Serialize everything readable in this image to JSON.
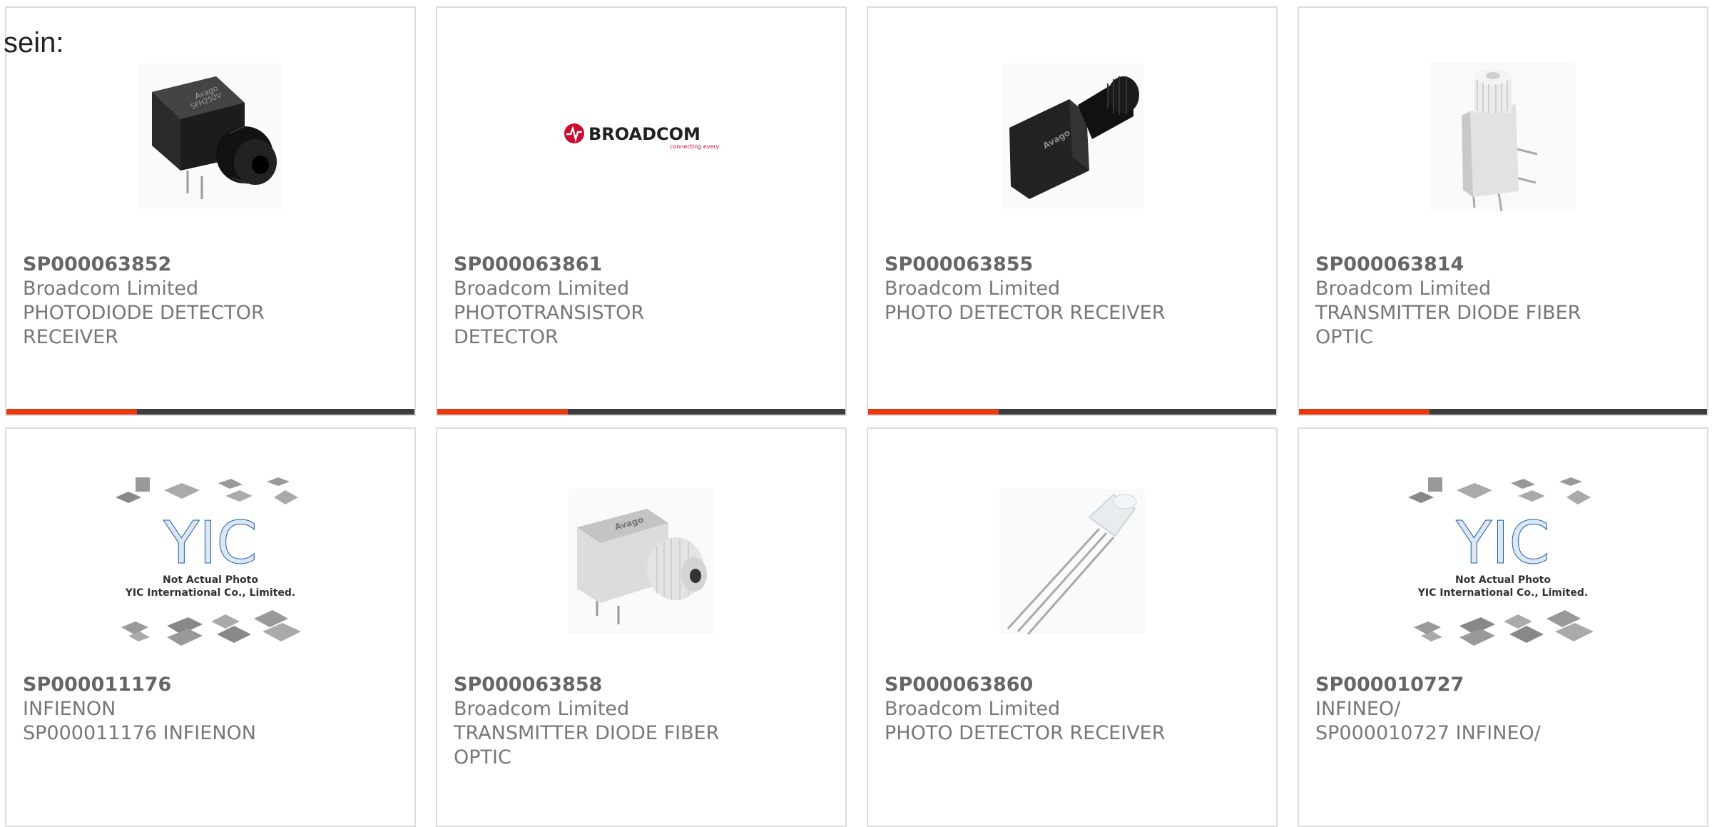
{
  "page": {
    "lead_text": "sein:"
  },
  "products": [
    {
      "part_number": "SP000063852",
      "manufacturer": "Broadcom Limited",
      "description": "PHOTODIODE DETECTOR RECEIVER",
      "image": "black-fiber-optic-receiver-photo",
      "photo_print": "Avago",
      "photo_print_2": "SFH250V"
    },
    {
      "part_number": "SP000063861",
      "manufacturer": "Broadcom Limited",
      "description": "PHOTOTRANSISTOR DETECTOR",
      "image": "broadcom-logo",
      "logo_text": "BROADCOM",
      "logo_tagline": "connecting everything"
    },
    {
      "part_number": "SP000063855",
      "manufacturer": "Broadcom Limited",
      "description": "PHOTO DETECTOR RECEIVER",
      "image": "black-fiber-optic-detector-photo",
      "photo_print": "Avago"
    },
    {
      "part_number": "SP000063814",
      "manufacturer": "Broadcom Limited",
      "description": "TRANSMITTER DIODE FIBER OPTIC",
      "image": "white-fiber-optic-transmitter-photo"
    },
    {
      "part_number": "SP000011176",
      "manufacturer": "INFIENON",
      "description": "SP000011176 INFIENON",
      "image": "not-actual-photo-placeholder",
      "placeholder_logo": "YIC",
      "placeholder_line1": "Not Actual Photo",
      "placeholder_line2": "YIC International Co., Limited."
    },
    {
      "part_number": "SP000063858",
      "manufacturer": "Broadcom Limited",
      "description": "TRANSMITTER DIODE FIBER OPTIC",
      "image": "grey-fiber-optic-transmitter-photo",
      "photo_print": "Avago"
    },
    {
      "part_number": "SP000063860",
      "manufacturer": "Broadcom Limited",
      "description": "PHOTO DETECTOR RECEIVER",
      "image": "clear-led-photodetector-photo"
    },
    {
      "part_number": "SP000010727",
      "manufacturer": "INFINEO/",
      "description": "SP000010727 INFINEO/",
      "image": "not-actual-photo-placeholder",
      "placeholder_logo": "YIC",
      "placeholder_line1": "Not Actual Photo",
      "placeholder_line2": "YIC International Co., Limited."
    }
  ],
  "colors": {
    "accent": "#e8380d",
    "bar_dark": "#3c3c3c",
    "card_border": "#dddddd",
    "text": "#777777",
    "logo_red": "#cc092f",
    "placeholder_blue": "#1a5fa8"
  }
}
